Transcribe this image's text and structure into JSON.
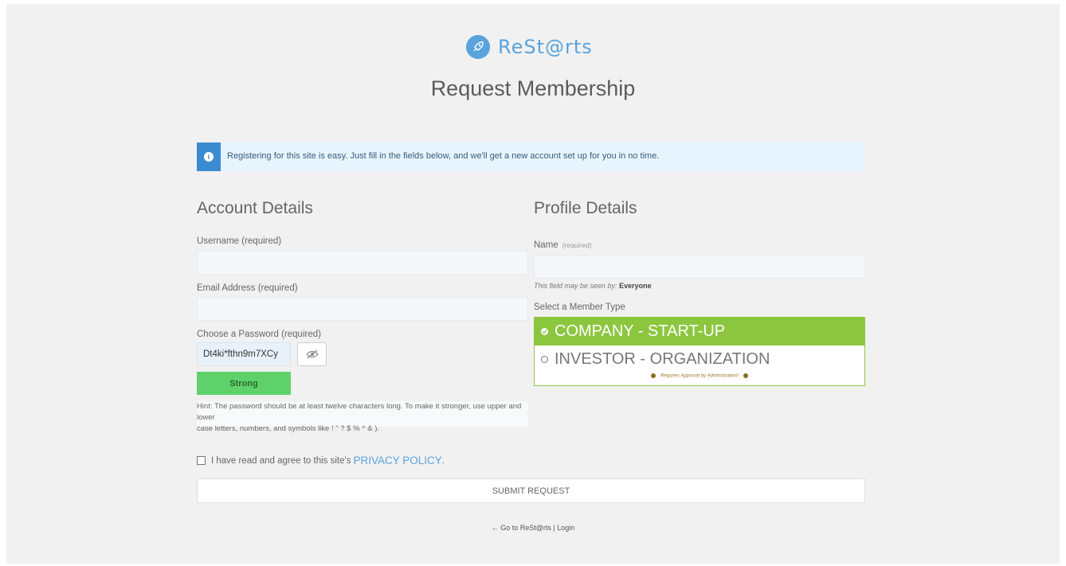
{
  "brand": {
    "name": "ReSt@rts",
    "accent": "#5aa3dc"
  },
  "page": {
    "title": "Request Membership"
  },
  "notice": {
    "text": "Registering for this site is easy. Just fill in the fields below, and we'll get a new account set up for you in no time.",
    "icon": "info-icon",
    "color": "#3b8bd3"
  },
  "account": {
    "title": "Account Details",
    "username_label": "Username (required)",
    "username_value": "",
    "email_label": "Email Address (required)",
    "email_value": "",
    "password_label": "Choose a Password (required)",
    "password_value": "Dt4ki*fthn9m7XCy",
    "toggle_icon": "eye-slash-icon",
    "strength": "Strong",
    "strength_color": "#5ed16a",
    "hint_line1": "Hint: The password should be at least twelve characters long. To make it stronger, use upper and lower",
    "hint_line2": "case letters, numbers, and symbols like ! \" ? $ % ^ & )."
  },
  "profile": {
    "title": "Profile Details",
    "name_label": "Name",
    "name_required": "(required)",
    "name_value": "",
    "visibility_prefix": "This field may be seen by:",
    "visibility_value": "Everyone",
    "member_type_label": "Select a Member Type",
    "options": [
      {
        "label": "COMPANY - START-UP",
        "selected": true,
        "color": "#8cc63f"
      },
      {
        "label": "INVESTOR - ORGANIZATION",
        "selected": false
      }
    ],
    "approval_note": "Requires Approval by Administration!"
  },
  "agree": {
    "text": "I have read and agree to this site's",
    "link": "PRIVACY POLICY",
    "suffix": ".",
    "checked": false
  },
  "submit": {
    "label": "SUBMIT REQUEST"
  },
  "footer": {
    "back_link": "← Go to ReSt@rts",
    "separator": "|",
    "login_link": "Login"
  }
}
